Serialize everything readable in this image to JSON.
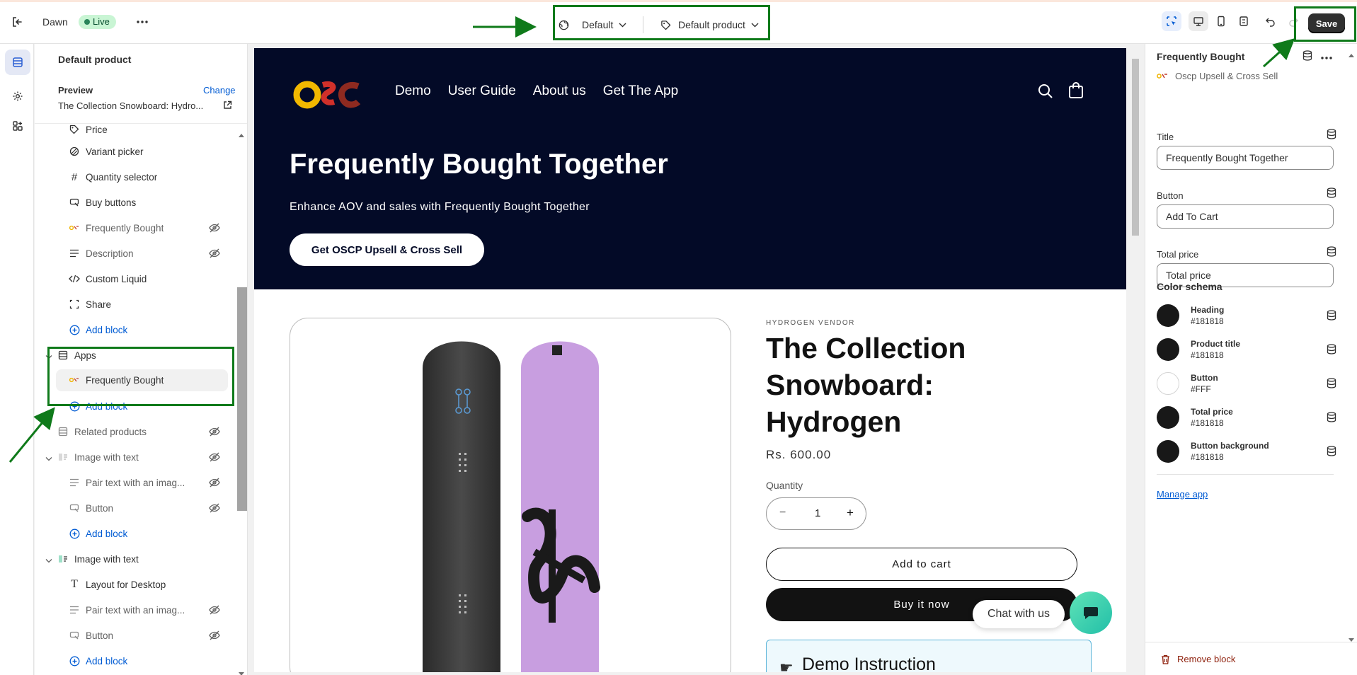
{
  "topbar": {
    "theme_name": "Dawn",
    "live_badge": "Live",
    "template_select": "Default",
    "product_select": "Default product",
    "save_label": "Save"
  },
  "sections": {
    "header": "Default product",
    "preview_label": "Preview",
    "change_label": "Change",
    "preview_value": "The Collection Snowboard: Hydro...",
    "items": [
      {
        "label": "Price"
      },
      {
        "label": "Variant picker"
      },
      {
        "label": "Quantity selector"
      },
      {
        "label": "Buy buttons"
      },
      {
        "label": "Frequently Bought"
      },
      {
        "label": "Description"
      },
      {
        "label": "Custom Liquid"
      },
      {
        "label": "Share"
      },
      {
        "label": "Add block"
      },
      {
        "label": "Apps"
      },
      {
        "label": "Frequently Bought"
      },
      {
        "label": "Add block"
      },
      {
        "label": "Related products"
      },
      {
        "label": "Image with text"
      },
      {
        "label": "Pair text with an imag..."
      },
      {
        "label": "Button"
      },
      {
        "label": "Add block"
      },
      {
        "label": "Image with text"
      },
      {
        "label": "Layout for Desktop"
      },
      {
        "label": "Pair text with an imag..."
      },
      {
        "label": "Button"
      },
      {
        "label": "Add block"
      }
    ]
  },
  "preview": {
    "nav": [
      "Demo",
      "User Guide",
      "About us",
      "Get The App"
    ],
    "hero_title": "Frequently Bought Together",
    "hero_subtitle": "Enhance AOV and sales with Frequently Bought Together",
    "hero_button": "Get OSCP Upsell & Cross Sell",
    "vendor": "HYDROGEN VENDOR",
    "product_title": "The Collection Snowboard: Hydrogen",
    "price": "Rs. 600.00",
    "quantity_label": "Quantity",
    "quantity_value": "1",
    "add_to_cart": "Add to cart",
    "buy_now": "Buy it now",
    "chat_label": "Chat with us",
    "demo_title": "Demo Instruction"
  },
  "settings": {
    "title": "Frequently Bought",
    "app_name": "Oscp Upsell & Cross Sell",
    "title_label": "Title",
    "title_value": "Frequently Bought Together",
    "button_label": "Button",
    "button_value": "Add To Cart",
    "total_label": "Total price",
    "total_value": "Total price",
    "color_schema_label": "Color schema",
    "swatches": [
      {
        "name": "Heading",
        "value": "#181818",
        "color": "#181818"
      },
      {
        "name": "Product title",
        "value": "#181818",
        "color": "#181818"
      },
      {
        "name": "Button",
        "value": "#FFF",
        "color": "#ffffff"
      },
      {
        "name": "Total price",
        "value": "#181818",
        "color": "#181818"
      },
      {
        "name": "Button background",
        "value": "#181818",
        "color": "#181818"
      }
    ],
    "manage_app": "Manage app",
    "remove_block": "Remove block"
  },
  "colors": {
    "accent": "#005bd3",
    "highlight": "#0f7a1a",
    "hero_bg": "#030a27"
  }
}
